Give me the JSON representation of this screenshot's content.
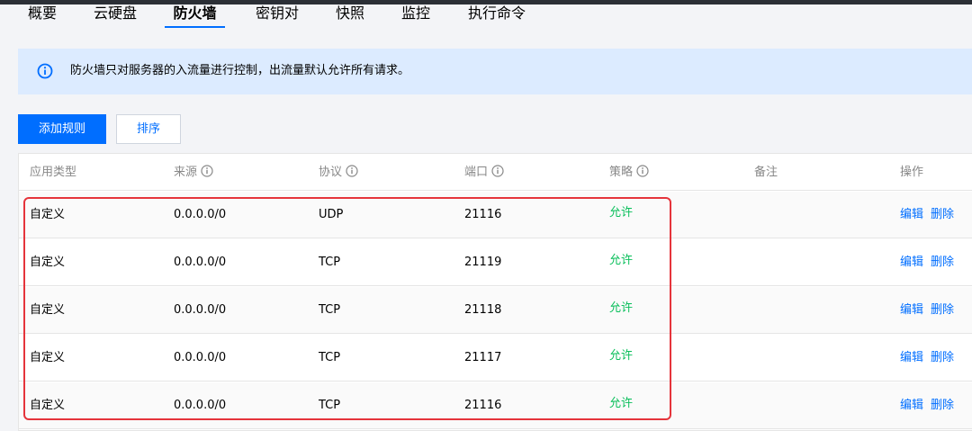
{
  "tabs": [
    {
      "label": "概要",
      "active": false
    },
    {
      "label": "云硬盘",
      "active": false
    },
    {
      "label": "防火墙",
      "active": true
    },
    {
      "label": "密钥对",
      "active": false
    },
    {
      "label": "快照",
      "active": false
    },
    {
      "label": "监控",
      "active": false
    },
    {
      "label": "执行命令",
      "active": false
    }
  ],
  "notice": {
    "icon": "info-icon",
    "text": "防火墙只对服务器的入流量进行控制，出流量默认允许所有请求。"
  },
  "toolbar": {
    "add_rule": "添加规则",
    "sort": "排序"
  },
  "table": {
    "headers": {
      "app_type": "应用类型",
      "source": "来源",
      "protocol": "协议",
      "port": "端口",
      "policy": "策略",
      "remark": "备注",
      "actions": "操作"
    },
    "rows": [
      {
        "app_type": "自定义",
        "source": "0.0.0.0/0",
        "protocol": "UDP",
        "port": "21116",
        "policy": "允许",
        "remark": "",
        "edit": "编辑",
        "delete": "删除"
      },
      {
        "app_type": "自定义",
        "source": "0.0.0.0/0",
        "protocol": "TCP",
        "port": "21119",
        "policy": "允许",
        "remark": "",
        "edit": "编辑",
        "delete": "删除"
      },
      {
        "app_type": "自定义",
        "source": "0.0.0.0/0",
        "protocol": "TCP",
        "port": "21118",
        "policy": "允许",
        "remark": "",
        "edit": "编辑",
        "delete": "删除"
      },
      {
        "app_type": "自定义",
        "source": "0.0.0.0/0",
        "protocol": "TCP",
        "port": "21117",
        "policy": "允许",
        "remark": "",
        "edit": "编辑",
        "delete": "删除"
      },
      {
        "app_type": "自定义",
        "source": "0.0.0.0/0",
        "protocol": "TCP",
        "port": "21116",
        "policy": "允许",
        "remark": "",
        "edit": "编辑",
        "delete": "删除"
      }
    ]
  },
  "colors": {
    "accent": "#006eff",
    "allow": "#0abf5b",
    "highlight": "#e5343b",
    "notice_bg": "#dcebff"
  }
}
